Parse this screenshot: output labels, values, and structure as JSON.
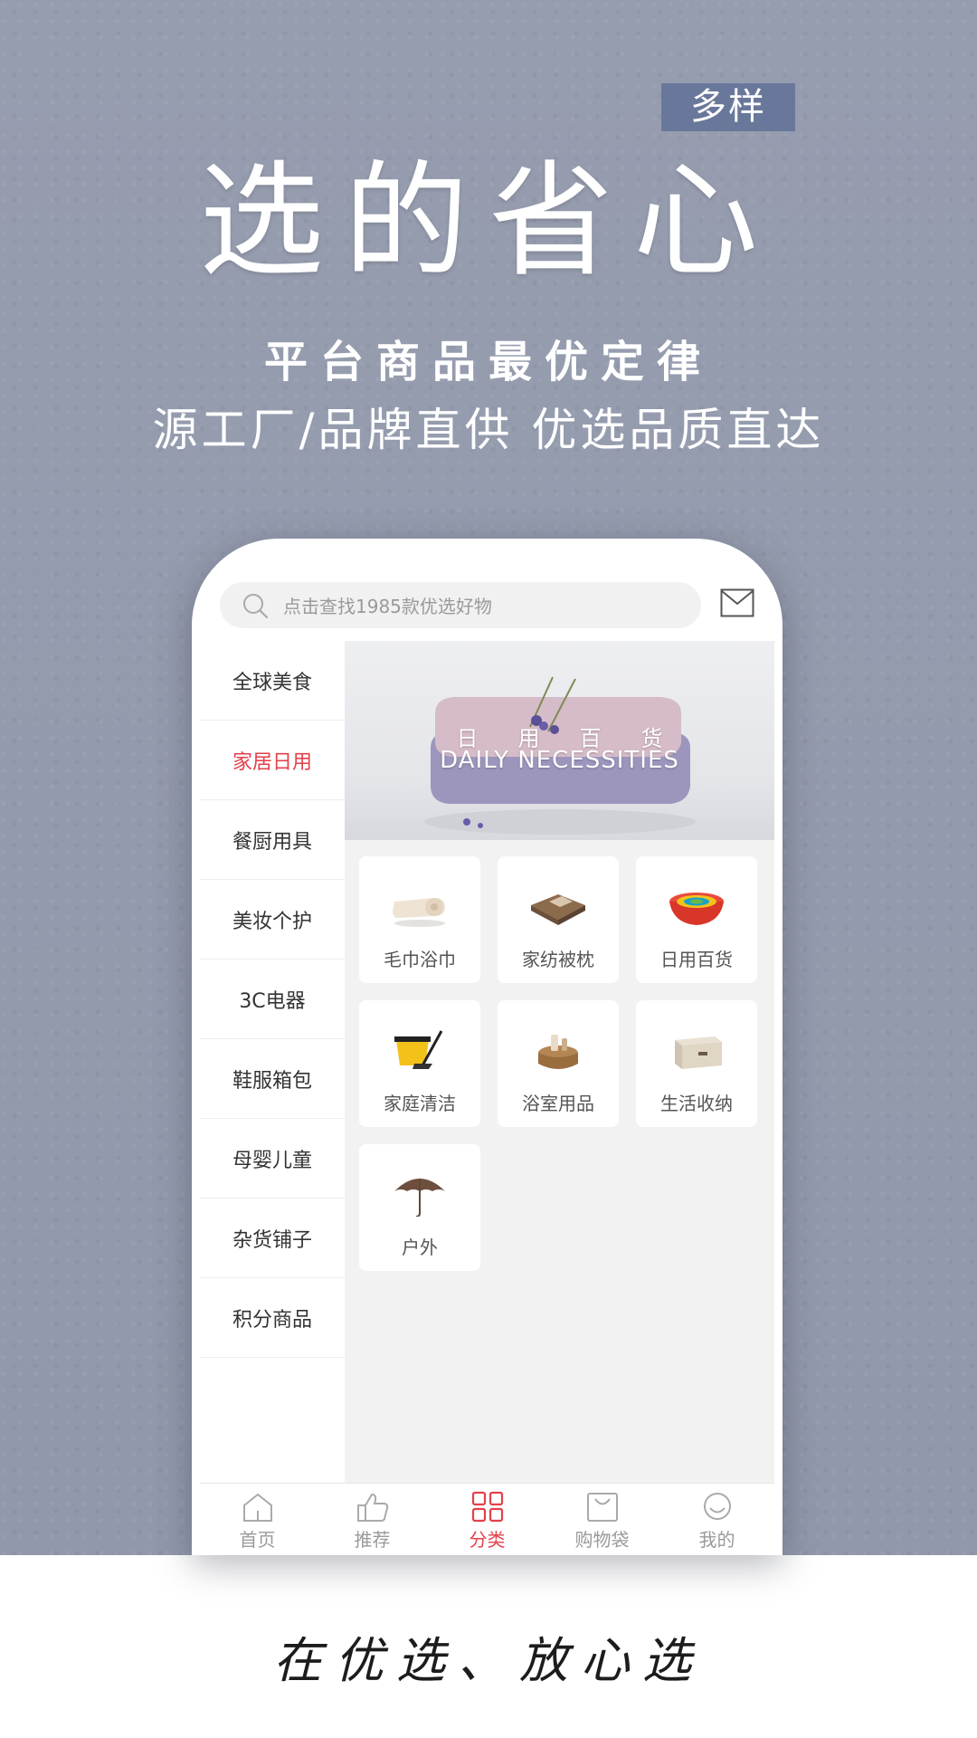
{
  "poster": {
    "tag": "多样",
    "headline": "选的省心",
    "subtitle_bold": "平台商品最优定律",
    "subtitle": "源工厂/品牌直供  优选品质直达",
    "slogan": "在优选、放心选"
  },
  "search": {
    "placeholder": "点击查找1985款优选好物"
  },
  "sidebar": {
    "active_index": 1,
    "items": [
      {
        "label": "全球美食"
      },
      {
        "label": "家居日用"
      },
      {
        "label": "餐厨用具"
      },
      {
        "label": "美妆个护"
      },
      {
        "label": "3C电器"
      },
      {
        "label": "鞋服箱包"
      },
      {
        "label": "母婴儿童"
      },
      {
        "label": "杂货铺子"
      },
      {
        "label": "积分商品"
      }
    ]
  },
  "banner": {
    "title_cn": "日用百货",
    "title_en": "DAILY NECESSITIES"
  },
  "categories": [
    {
      "label": "毛巾浴巾",
      "icon": "towel-icon"
    },
    {
      "label": "家纺被枕",
      "icon": "bedding-icon"
    },
    {
      "label": "日用百货",
      "icon": "bowls-icon"
    },
    {
      "label": "家庭清洁",
      "icon": "mop-bucket-icon"
    },
    {
      "label": "浴室用品",
      "icon": "bath-set-icon"
    },
    {
      "label": "生活收纳",
      "icon": "storage-box-icon"
    },
    {
      "label": "户外",
      "icon": "umbrella-icon"
    }
  ],
  "tabbar": {
    "active_index": 2,
    "tabs": [
      {
        "label": "首页",
        "icon": "home-icon"
      },
      {
        "label": "推荐",
        "icon": "thumbs-up-icon"
      },
      {
        "label": "分类",
        "icon": "category-grid-icon"
      },
      {
        "label": "购物袋",
        "icon": "shopping-bag-icon"
      },
      {
        "label": "我的",
        "icon": "profile-icon"
      }
    ]
  },
  "colors": {
    "accent": "#e3414b",
    "tag_bg": "#69789a",
    "poster_bg": "#959cae"
  }
}
